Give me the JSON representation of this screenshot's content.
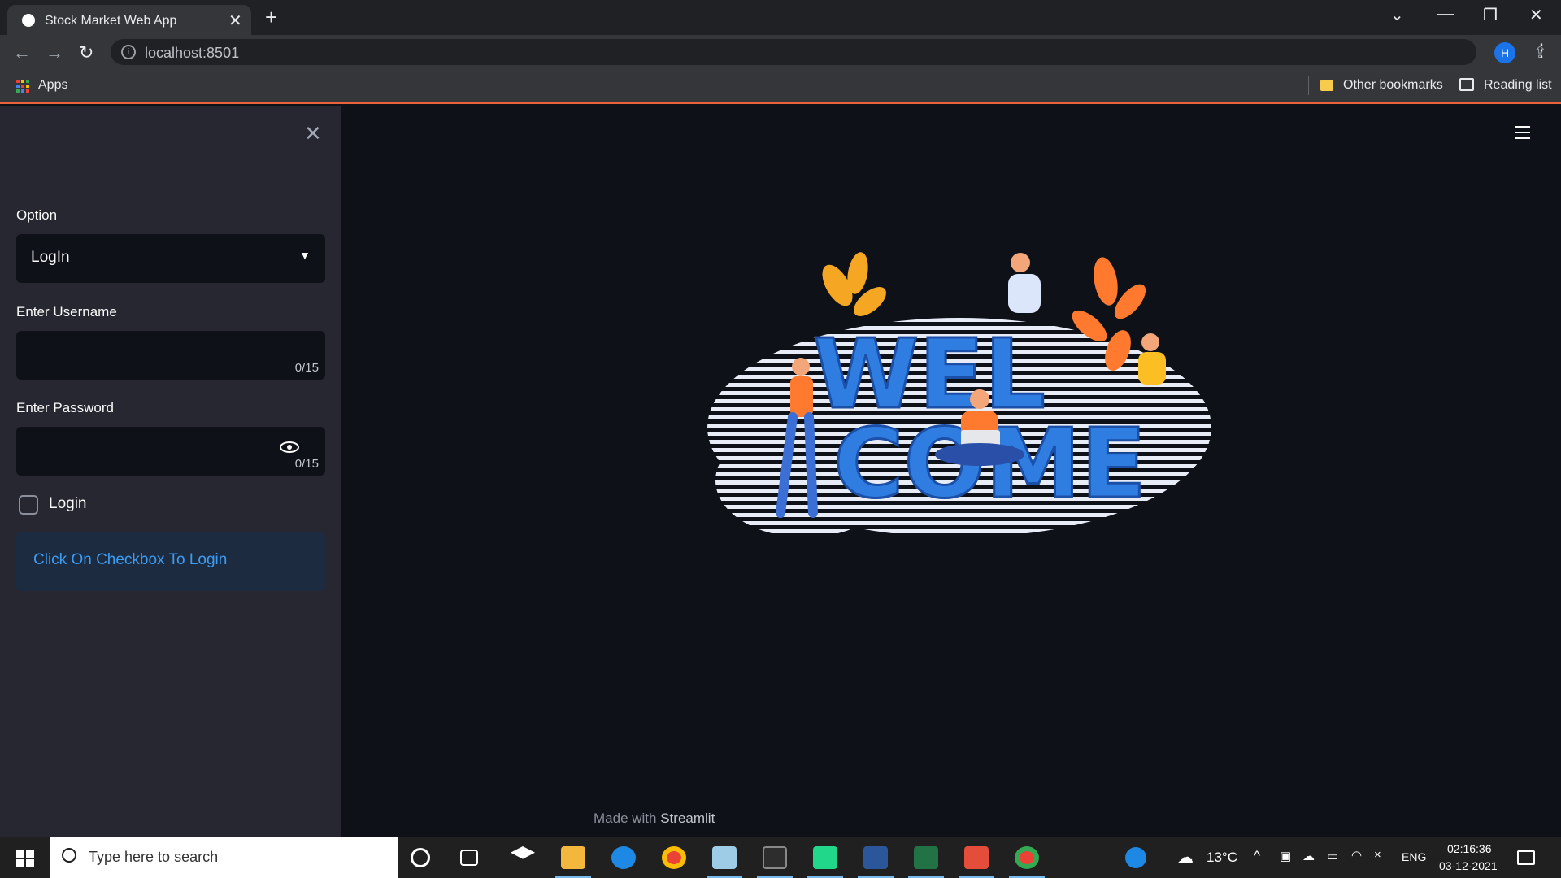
{
  "browser": {
    "tab_title": "Stock Market Web App",
    "url": "localhost:8501",
    "profile_initial": "H",
    "bookmarks": {
      "apps": "Apps",
      "other": "Other bookmarks",
      "reading_list": "Reading list"
    }
  },
  "sidebar": {
    "option_label": "Option",
    "option_value": "LogIn",
    "username_label": "Enter Username",
    "username_counter": "0/15",
    "password_label": "Enter Password",
    "password_counter": "0/15",
    "checkbox_label": "Login",
    "info_message": "Click On Checkbox To Login"
  },
  "main": {
    "image_text": "WELCOME",
    "footer_prefix": "Made with",
    "footer_brand": "Streamlit"
  },
  "taskbar": {
    "search_placeholder": "Type here to search",
    "weather": "13°C",
    "language": "ENG",
    "time": "02:16:36",
    "date": "03-12-2021"
  },
  "colors": {
    "sidebar_bg": "#262730",
    "main_bg": "#0e1117",
    "info_text": "#3d9df3",
    "accent_line": "#e8633a"
  }
}
